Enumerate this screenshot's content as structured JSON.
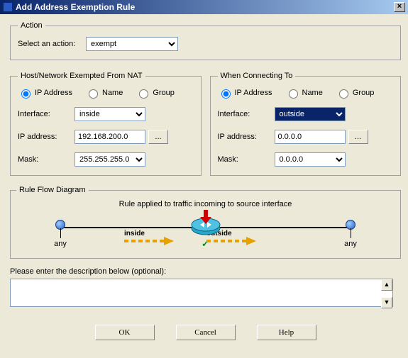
{
  "window": {
    "title": "Add Address Exemption Rule"
  },
  "action": {
    "legend": "Action",
    "label": "Select an action:",
    "value": "exempt"
  },
  "source": {
    "legend": "Host/Network Exempted From NAT",
    "radio_ip": "IP Address",
    "radio_name": "Name",
    "radio_group": "Group",
    "selected": "ip",
    "interface_label": "Interface:",
    "interface_value": "inside",
    "ip_label": "IP address:",
    "ip_value": "192.168.200.0",
    "mask_label": "Mask:",
    "mask_value": "255.255.255.0",
    "browse": "..."
  },
  "dest": {
    "legend": "When Connecting To",
    "radio_ip": "IP Address",
    "radio_name": "Name",
    "radio_group": "Group",
    "selected": "ip",
    "interface_label": "Interface:",
    "interface_value": "outside",
    "ip_label": "IP address:",
    "ip_value": "0.0.0.0",
    "mask_label": "Mask:",
    "mask_value": "0.0.0.0",
    "browse": "..."
  },
  "flow": {
    "legend": "Rule Flow Diagram",
    "caption": "Rule applied to traffic incoming to source interface",
    "left_label": "any",
    "right_label": "any",
    "inside": "inside",
    "outside": "outside"
  },
  "desc": {
    "label": "Please enter the description below (optional):",
    "value": ""
  },
  "buttons": {
    "ok": "OK",
    "cancel": "Cancel",
    "help": "Help"
  }
}
